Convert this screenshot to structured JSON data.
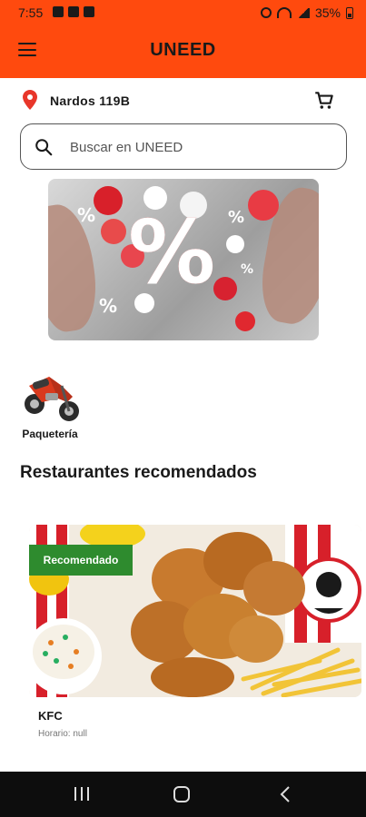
{
  "status_bar": {
    "time": "7:55",
    "battery": "35%"
  },
  "app": {
    "title": "UNEED",
    "accent": "#ff4a0e"
  },
  "location": {
    "address": "Nardos 119B"
  },
  "search": {
    "placeholder": "Buscar en UNEED"
  },
  "categories": [
    {
      "label": "Paquetería",
      "icon": "motorcycle-icon"
    }
  ],
  "section": {
    "title": "Restaurantes recomendados"
  },
  "restaurants": [
    {
      "badge": "Recomendado",
      "name": "KFC",
      "hours": "Horario: null",
      "badge_color": "#2e8b2e"
    }
  ],
  "nav": {
    "icons": [
      "recents-icon",
      "home-icon",
      "back-icon"
    ]
  }
}
